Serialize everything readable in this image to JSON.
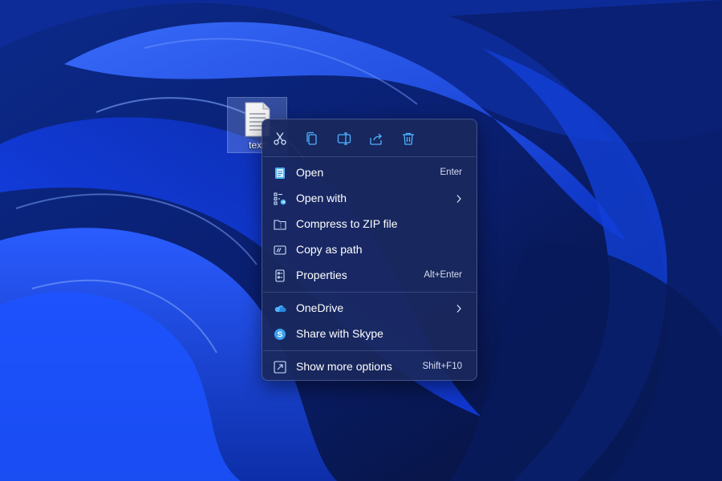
{
  "desktop": {
    "file_label": "textf"
  },
  "quick_actions": [
    {
      "name": "cut",
      "icon": "scissors-icon"
    },
    {
      "name": "copy",
      "icon": "copy-icon"
    },
    {
      "name": "rename",
      "icon": "rename-icon"
    },
    {
      "name": "share",
      "icon": "share-icon"
    },
    {
      "name": "delete",
      "icon": "trash-icon"
    }
  ],
  "menu": {
    "open": {
      "label": "Open",
      "shortcut": "Enter",
      "icon": "notepad-icon"
    },
    "open_with": {
      "label": "Open with",
      "icon": "open-with-icon",
      "has_submenu": true
    },
    "compress": {
      "label": "Compress to ZIP file",
      "icon": "zip-folder-icon"
    },
    "copy_path": {
      "label": "Copy as path",
      "icon": "path-icon"
    },
    "properties": {
      "label": "Properties",
      "shortcut": "Alt+Enter",
      "icon": "properties-icon"
    },
    "onedrive": {
      "label": "OneDrive",
      "icon": "onedrive-icon",
      "has_submenu": true
    },
    "skype": {
      "label": "Share with Skype",
      "icon": "skype-icon"
    },
    "more_options": {
      "label": "Show more options",
      "shortcut": "Shift+F10",
      "icon": "more-options-icon"
    }
  },
  "colors": {
    "menu_background": "#1a285c",
    "icon_accent": "#4fb3ff",
    "text": "#ffffff"
  }
}
